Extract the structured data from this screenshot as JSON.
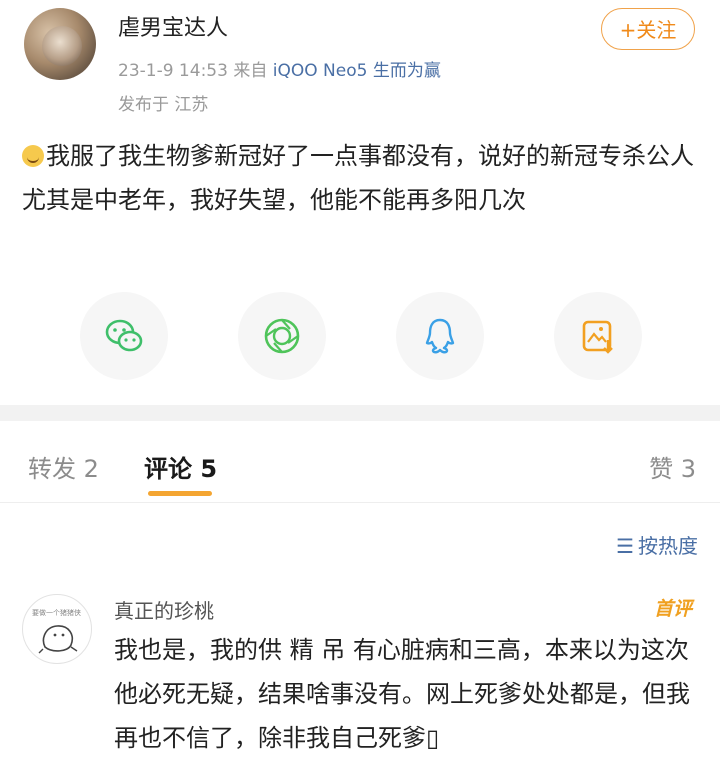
{
  "post": {
    "username": "虐男宝达人",
    "time": "23-1-9 14:53",
    "source_prefix": "来自",
    "source": "iQOO Neo5 生而为赢",
    "location": "发布于 江苏",
    "follow_label": "+关注",
    "text": "我服了我生物爹新冠好了一点事都没有，说好的新冠专杀公人尤其是中老年，我好失望，他能不能再多阳几次",
    "emoji": "sleepy-face-emoji"
  },
  "share": {
    "items": [
      {
        "name": "wechat",
        "icon": "wechat-icon",
        "color": "#3fbf6a"
      },
      {
        "name": "moments",
        "icon": "moments-icon",
        "color": "#4fc45a"
      },
      {
        "name": "qq",
        "icon": "qq-icon",
        "color": "#3aa0e6"
      },
      {
        "name": "save-image",
        "icon": "save-image-icon",
        "color": "#f2a021"
      }
    ]
  },
  "tabs": {
    "repost": "转发 2",
    "comments": "评论 5",
    "likes": "赞 3"
  },
  "sort": {
    "label": "按热度"
  },
  "comments": [
    {
      "author": "真正的珍桃",
      "avatar_caption": "要做一个猪猪侠",
      "badge": "首评",
      "text": "我也是，我的供 精 吊 有心脏病和三高，本来以为这次他必死无疑，结果啥事没有。网上死爹处处都是，但我再也不信了，除非我自己死爹▯"
    }
  ],
  "colors": {
    "accent": "#f4a531",
    "link": "#4a6fa5"
  }
}
